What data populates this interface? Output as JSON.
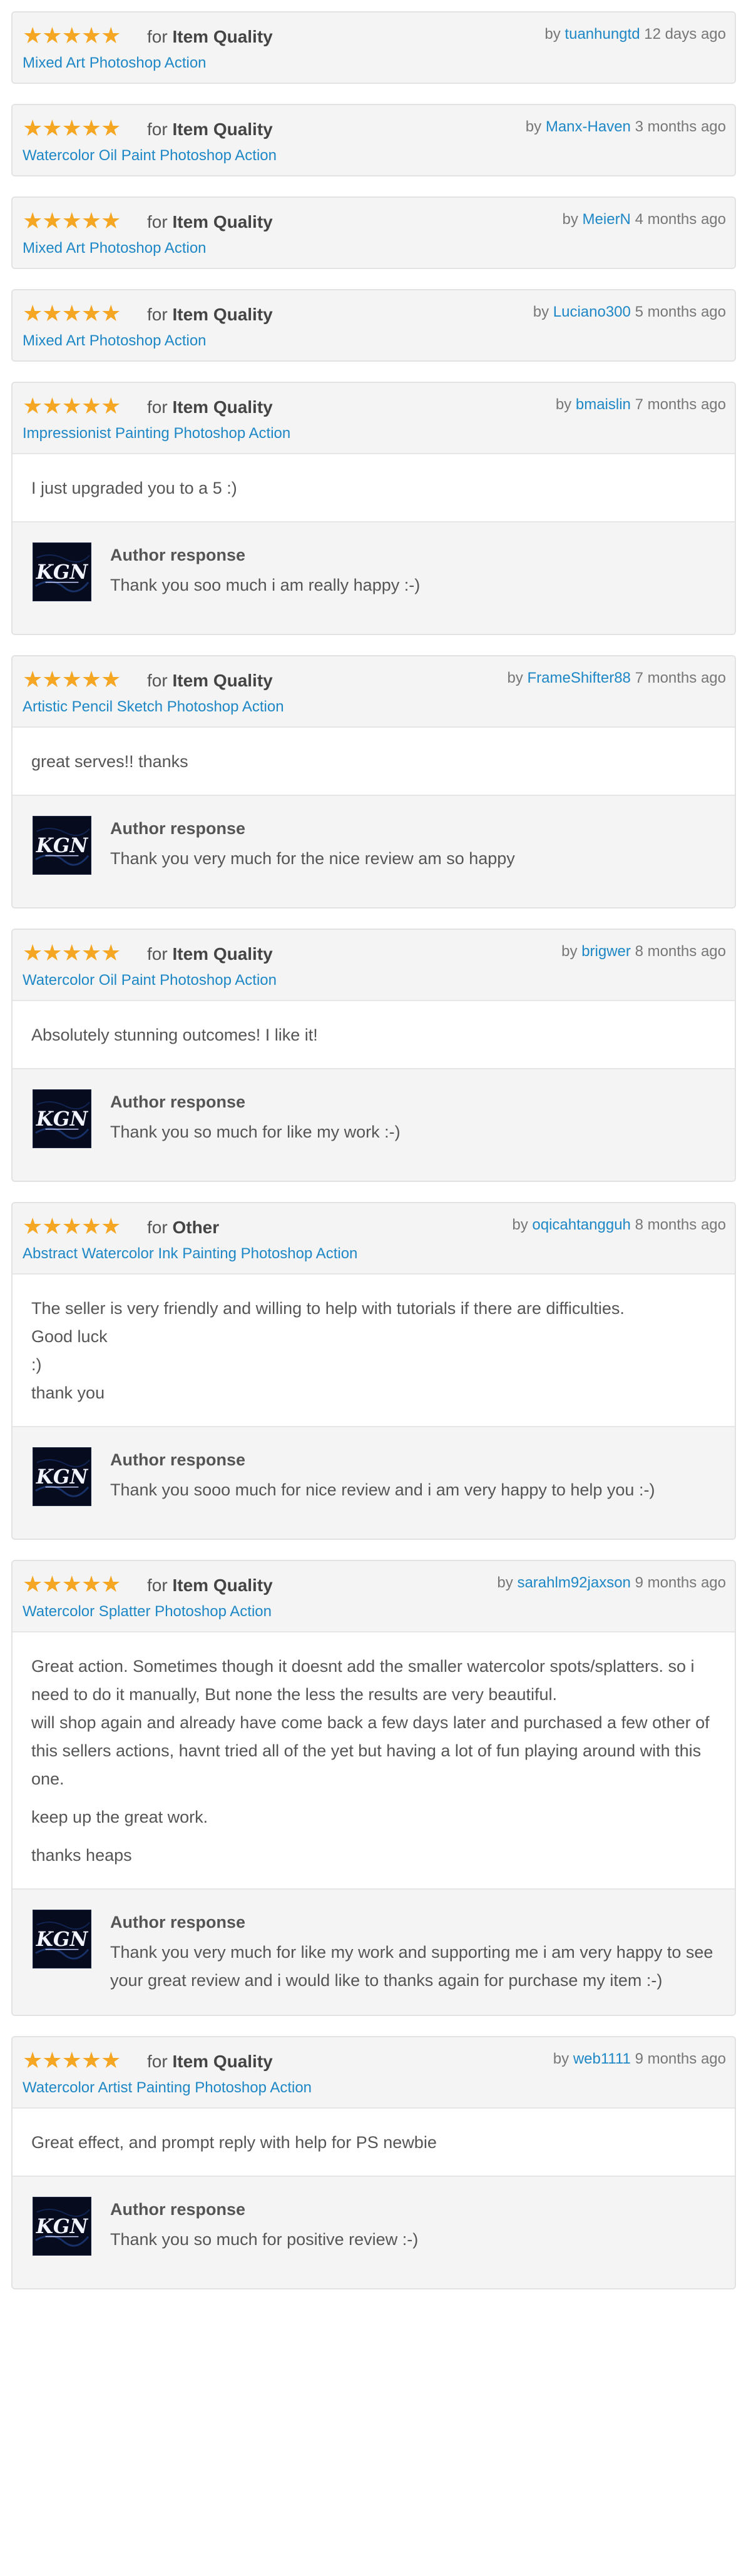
{
  "ui": {
    "for_word": "for",
    "by_word": "by",
    "author_response_label": "Author response",
    "accent_color": "#1e87c6",
    "star_color": "#f5a623",
    "star_icon": "star-icon"
  },
  "reviews": [
    {
      "stars": 5,
      "category": "Item Quality",
      "item": "Mixed Art Photoshop Action",
      "user": "tuanhungtd",
      "time": "12 days ago",
      "body": [],
      "response": null
    },
    {
      "stars": 5,
      "category": "Item Quality",
      "item": "Watercolor Oil Paint Photoshop Action",
      "user": "Manx-Haven",
      "time": "3 months ago",
      "body": [],
      "response": null
    },
    {
      "stars": 5,
      "category": "Item Quality",
      "item": "Mixed Art Photoshop Action",
      "user": "MeierN",
      "time": "4 months ago",
      "body": [],
      "response": null
    },
    {
      "stars": 5,
      "category": "Item Quality",
      "item": "Mixed Art Photoshop Action",
      "user": "Luciano300",
      "time": "5 months ago",
      "body": [],
      "response": null
    },
    {
      "stars": 5,
      "category": "Item Quality",
      "item": "Impressionist Painting Photoshop Action",
      "user": "bmaislin",
      "time": "7 months ago",
      "body": [
        "I just upgraded you to a 5 :)"
      ],
      "response": "Thank you soo much i am really happy :-)"
    },
    {
      "stars": 5,
      "category": "Item Quality",
      "item": "Artistic Pencil Sketch Photoshop Action",
      "user": "FrameShifter88",
      "time": "7 months ago",
      "body": [
        "great serves!! thanks"
      ],
      "response": "Thank you very much for the nice review am so happy"
    },
    {
      "stars": 5,
      "category": "Item Quality",
      "item": "Watercolor Oil Paint Photoshop Action",
      "user": "brigwer",
      "time": "8 months ago",
      "body": [
        "Absolutely stunning outcomes! I like it!"
      ],
      "response": "Thank you so much for like my work :-)"
    },
    {
      "stars": 5,
      "category": "Other",
      "item": "Abstract Watercolor Ink Painting Photoshop Action",
      "user": "oqicahtangguh",
      "time": "8 months ago",
      "body": [
        "The seller is very friendly and willing to help with tutorials if there are difficulties.\nGood luck\n:)\nthank you"
      ],
      "response": "Thank you sooo much for nice review and i am very happy to help you :-)"
    },
    {
      "stars": 5,
      "category": "Item Quality",
      "item": "Watercolor Splatter Photoshop Action",
      "user": "sarahlm92jaxson",
      "time": "9 months ago",
      "body": [
        "Great action. Sometimes though it doesnt add the smaller watercolor spots/splatters. so i need to do it manually, But none the less the results are very beautiful.\nwill shop again and already have come back a few days later and purchased a few other of this sellers actions, havnt tried all of the yet but having a lot of fun playing around with this one.",
        "keep up the great work.",
        "thanks heaps"
      ],
      "response": "Thank you very much for like my work and supporting me i am very happy to see your great review and i would like to thanks again for purchase my item :-)"
    },
    {
      "stars": 5,
      "category": "Item Quality",
      "item": "Watercolor Artist Painting Photoshop Action",
      "user": "web1111",
      "time": "9 months ago",
      "body": [
        "Great effect, and prompt reply with help for PS newbie"
      ],
      "response": "Thank you so much for positive review :-)"
    }
  ]
}
